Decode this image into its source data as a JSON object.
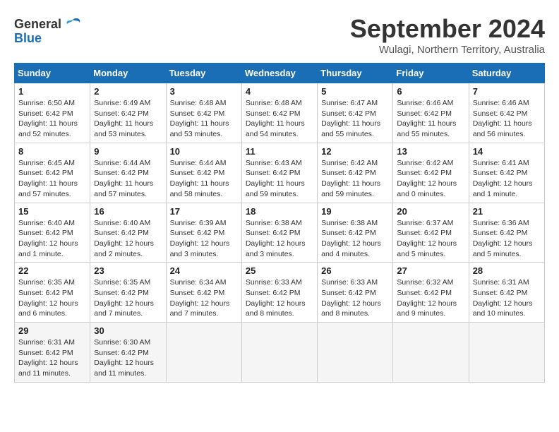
{
  "logo": {
    "line1": "General",
    "line2": "Blue"
  },
  "title": "September 2024",
  "subtitle": "Wulagi, Northern Territory, Australia",
  "days_header": [
    "Sunday",
    "Monday",
    "Tuesday",
    "Wednesday",
    "Thursday",
    "Friday",
    "Saturday"
  ],
  "weeks": [
    [
      {
        "day": "1",
        "sunrise": "6:50 AM",
        "sunset": "6:42 PM",
        "daylight": "11 hours and 52 minutes."
      },
      {
        "day": "2",
        "sunrise": "6:49 AM",
        "sunset": "6:42 PM",
        "daylight": "11 hours and 53 minutes."
      },
      {
        "day": "3",
        "sunrise": "6:48 AM",
        "sunset": "6:42 PM",
        "daylight": "11 hours and 53 minutes."
      },
      {
        "day": "4",
        "sunrise": "6:48 AM",
        "sunset": "6:42 PM",
        "daylight": "11 hours and 54 minutes."
      },
      {
        "day": "5",
        "sunrise": "6:47 AM",
        "sunset": "6:42 PM",
        "daylight": "11 hours and 55 minutes."
      },
      {
        "day": "6",
        "sunrise": "6:46 AM",
        "sunset": "6:42 PM",
        "daylight": "11 hours and 55 minutes."
      },
      {
        "day": "7",
        "sunrise": "6:46 AM",
        "sunset": "6:42 PM",
        "daylight": "11 hours and 56 minutes."
      }
    ],
    [
      {
        "day": "8",
        "sunrise": "6:45 AM",
        "sunset": "6:42 PM",
        "daylight": "11 hours and 57 minutes."
      },
      {
        "day": "9",
        "sunrise": "6:44 AM",
        "sunset": "6:42 PM",
        "daylight": "11 hours and 57 minutes."
      },
      {
        "day": "10",
        "sunrise": "6:44 AM",
        "sunset": "6:42 PM",
        "daylight": "11 hours and 58 minutes."
      },
      {
        "day": "11",
        "sunrise": "6:43 AM",
        "sunset": "6:42 PM",
        "daylight": "11 hours and 59 minutes."
      },
      {
        "day": "12",
        "sunrise": "6:42 AM",
        "sunset": "6:42 PM",
        "daylight": "11 hours and 59 minutes."
      },
      {
        "day": "13",
        "sunrise": "6:42 AM",
        "sunset": "6:42 PM",
        "daylight": "12 hours and 0 minutes."
      },
      {
        "day": "14",
        "sunrise": "6:41 AM",
        "sunset": "6:42 PM",
        "daylight": "12 hours and 1 minute."
      }
    ],
    [
      {
        "day": "15",
        "sunrise": "6:40 AM",
        "sunset": "6:42 PM",
        "daylight": "12 hours and 1 minute."
      },
      {
        "day": "16",
        "sunrise": "6:40 AM",
        "sunset": "6:42 PM",
        "daylight": "12 hours and 2 minutes."
      },
      {
        "day": "17",
        "sunrise": "6:39 AM",
        "sunset": "6:42 PM",
        "daylight": "12 hours and 3 minutes."
      },
      {
        "day": "18",
        "sunrise": "6:38 AM",
        "sunset": "6:42 PM",
        "daylight": "12 hours and 3 minutes."
      },
      {
        "day": "19",
        "sunrise": "6:38 AM",
        "sunset": "6:42 PM",
        "daylight": "12 hours and 4 minutes."
      },
      {
        "day": "20",
        "sunrise": "6:37 AM",
        "sunset": "6:42 PM",
        "daylight": "12 hours and 5 minutes."
      },
      {
        "day": "21",
        "sunrise": "6:36 AM",
        "sunset": "6:42 PM",
        "daylight": "12 hours and 5 minutes."
      }
    ],
    [
      {
        "day": "22",
        "sunrise": "6:35 AM",
        "sunset": "6:42 PM",
        "daylight": "12 hours and 6 minutes."
      },
      {
        "day": "23",
        "sunrise": "6:35 AM",
        "sunset": "6:42 PM",
        "daylight": "12 hours and 7 minutes."
      },
      {
        "day": "24",
        "sunrise": "6:34 AM",
        "sunset": "6:42 PM",
        "daylight": "12 hours and 7 minutes."
      },
      {
        "day": "25",
        "sunrise": "6:33 AM",
        "sunset": "6:42 PM",
        "daylight": "12 hours and 8 minutes."
      },
      {
        "day": "26",
        "sunrise": "6:33 AM",
        "sunset": "6:42 PM",
        "daylight": "12 hours and 8 minutes."
      },
      {
        "day": "27",
        "sunrise": "6:32 AM",
        "sunset": "6:42 PM",
        "daylight": "12 hours and 9 minutes."
      },
      {
        "day": "28",
        "sunrise": "6:31 AM",
        "sunset": "6:42 PM",
        "daylight": "12 hours and 10 minutes."
      }
    ],
    [
      {
        "day": "29",
        "sunrise": "6:31 AM",
        "sunset": "6:42 PM",
        "daylight": "12 hours and 11 minutes."
      },
      {
        "day": "30",
        "sunrise": "6:30 AM",
        "sunset": "6:42 PM",
        "daylight": "12 hours and 11 minutes."
      },
      null,
      null,
      null,
      null,
      null
    ]
  ],
  "labels": {
    "sunrise": "Sunrise: ",
    "sunset": "Sunset: ",
    "daylight": "Daylight: "
  }
}
